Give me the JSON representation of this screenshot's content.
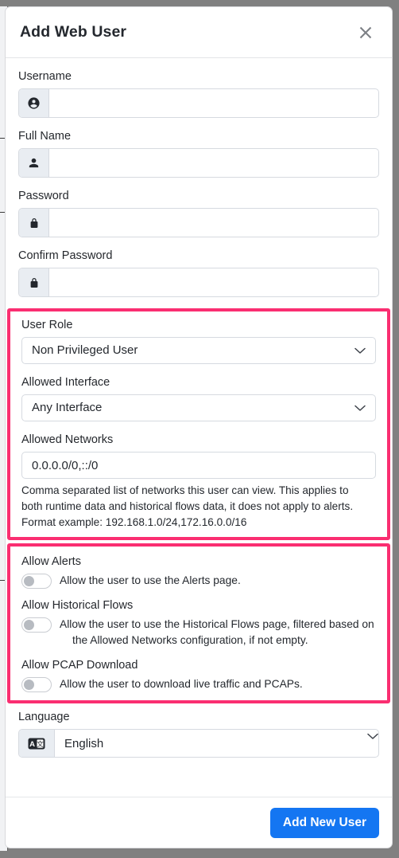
{
  "modal": {
    "title": "Add Web User",
    "close_icon": "close-icon"
  },
  "fields": {
    "username": {
      "label": "Username",
      "value": "",
      "placeholder": "",
      "icon": "account-circle-icon"
    },
    "full_name": {
      "label": "Full Name",
      "value": "",
      "placeholder": "",
      "icon": "person-icon"
    },
    "password": {
      "label": "Password",
      "value": "",
      "placeholder": "",
      "icon": "lock-icon"
    },
    "confirm_password": {
      "label": "Confirm Password",
      "value": "",
      "placeholder": "",
      "icon": "lock-icon"
    },
    "user_role": {
      "label": "User Role",
      "value": "Non Privileged User",
      "icon": "chevron-down-icon"
    },
    "allowed_interface": {
      "label": "Allowed Interface",
      "value": "Any Interface",
      "icon": "chevron-down-icon"
    },
    "allowed_networks": {
      "label": "Allowed Networks",
      "value": "0.0.0.0/0,::/0",
      "placeholder": "",
      "help_line1": "Comma separated list of networks this user can view. This applies to",
      "help_line2": "both runtime data and historical flows data, it does not apply to alerts.",
      "help_line3": "Format example: 192.168.1.0/24,172.16.0.0/16"
    },
    "language": {
      "label": "Language",
      "value": "English",
      "icon": "translate-icon"
    }
  },
  "toggles": {
    "allow_alerts": {
      "title": "Allow Alerts",
      "description": "Allow the user to use the Alerts page.",
      "state": "off"
    },
    "allow_historical_flows": {
      "title": "Allow Historical Flows",
      "description_line1": "Allow the user to use the Historical Flows page, filtered based on",
      "description_line2": "the Allowed Networks configuration, if not empty.",
      "state": "off"
    },
    "allow_pcap_download": {
      "title": "Allow PCAP Download",
      "description": "Allow the user to download live traffic and PCAPs.",
      "state": "off"
    }
  },
  "footer": {
    "submit_label": "Add New User"
  },
  "colors": {
    "highlight": "#fa2e71",
    "primary_button": "#1476f2",
    "addon_background": "#e9edf2",
    "border": "#d6dae0"
  }
}
